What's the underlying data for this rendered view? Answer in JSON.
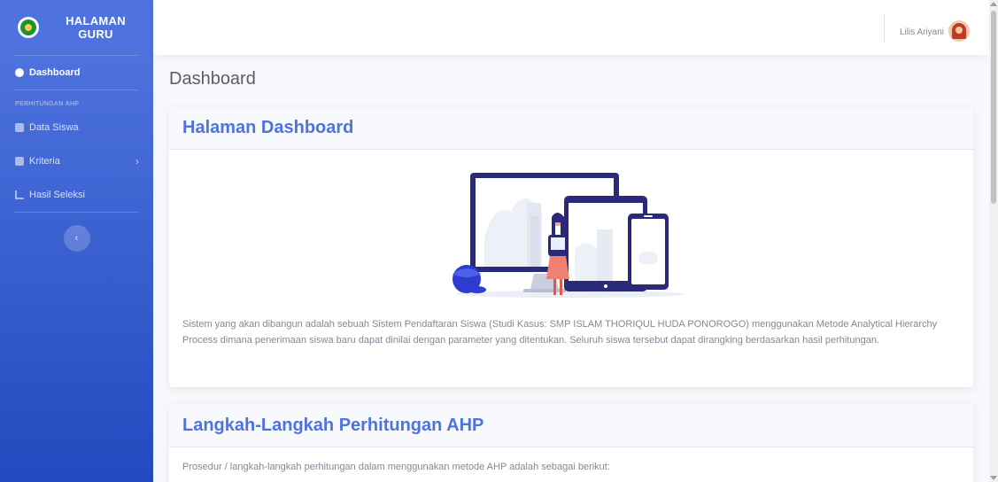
{
  "brand": {
    "line1": "HALAMAN",
    "line2": "GURU"
  },
  "sidebar": {
    "dashboard": "Dashboard",
    "heading": "PERHITUNGAN AHP",
    "items": [
      {
        "label": "Data Siswa",
        "icon": "database-icon"
      },
      {
        "label": "Kriteria",
        "icon": "database-icon"
      },
      {
        "label": "Hasil Seleksi",
        "icon": "chart-icon"
      }
    ],
    "toggle": "‹"
  },
  "topbar": {
    "user_name": "Lilis Ariyani"
  },
  "page": {
    "title": "Dashboard"
  },
  "cards": [
    {
      "title": "Halaman Dashboard",
      "text": "Sistem yang akan dibangun adalah sebuah Sistem Pendaftaran Siswa (Studi Kasus: SMP ISLAM THORIQUL HUDA PONOROGO) menggunakan Metode Analytical Hierarchy Process dimana penerimaan siswa baru dapat dinilai dengan parameter yang ditentukan. Seluruh siswa tersebut dapat dirangking berdasarkan hasil perhitungan."
    },
    {
      "title": "Langkah-Langkah Perhitungan AHP",
      "text": "Prosedur / langkah-langkah perhitungan dalam menggunakan metode AHP adalah sebagai berikut:"
    }
  ],
  "colors": {
    "primary": "#4e73df",
    "sidebar_bottom": "#224abe",
    "illustration_navy": "#2b2a7a"
  }
}
